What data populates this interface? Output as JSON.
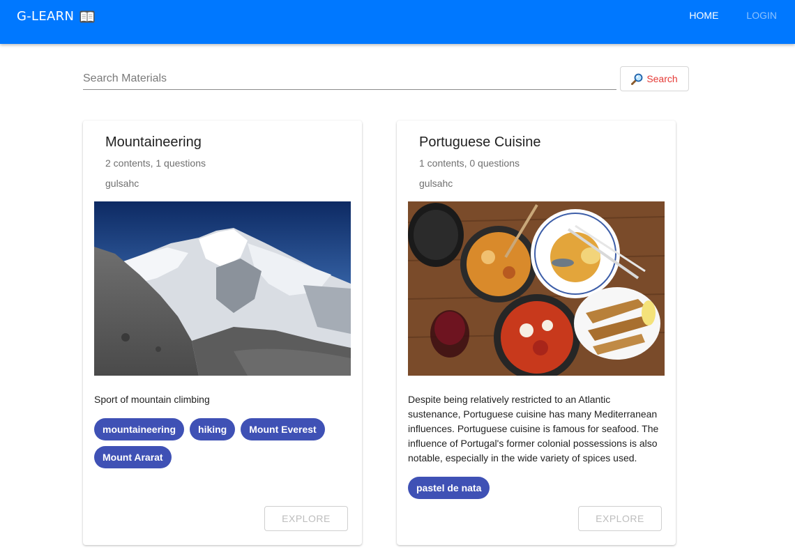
{
  "appbar": {
    "brand": "G-LEARN",
    "brand_icon": "open-book-icon",
    "nav": {
      "home": "HOME",
      "login": "LOGIN"
    },
    "color": "#0078ff"
  },
  "search": {
    "placeholder": "Search Materials",
    "value": "",
    "button_label": "Search",
    "button_icon": "magnifier-icon",
    "button_color": "#e53935"
  },
  "cards": [
    {
      "title": "Mountaineering",
      "meta": "2 contents, 1 questions",
      "author": "gulsahc",
      "image": "snowy-mountain-photo",
      "description": "Sport of mountain climbing",
      "tags": [
        "mountaineering",
        "hiking",
        "Mount Everest",
        "Mount Ararat"
      ],
      "explore_label": "EXPLORE"
    },
    {
      "title": "Portuguese Cuisine",
      "meta": "1 contents, 0 questions",
      "author": "gulsahc",
      "image": "portuguese-food-photo",
      "description": "Despite being relatively restricted to an Atlantic sustenance, Portuguese cuisine has many Mediterranean influences. Portuguese cuisine is famous for seafood. The influence of Portugal's former colonial possessions is also notable, especially in the wide variety of spices used.",
      "tags": [
        "pastel de nata"
      ],
      "explore_label": "EXPLORE"
    }
  ],
  "colors": {
    "chip": "#3f51b5",
    "explore_disabled": "#bdbdbd"
  }
}
